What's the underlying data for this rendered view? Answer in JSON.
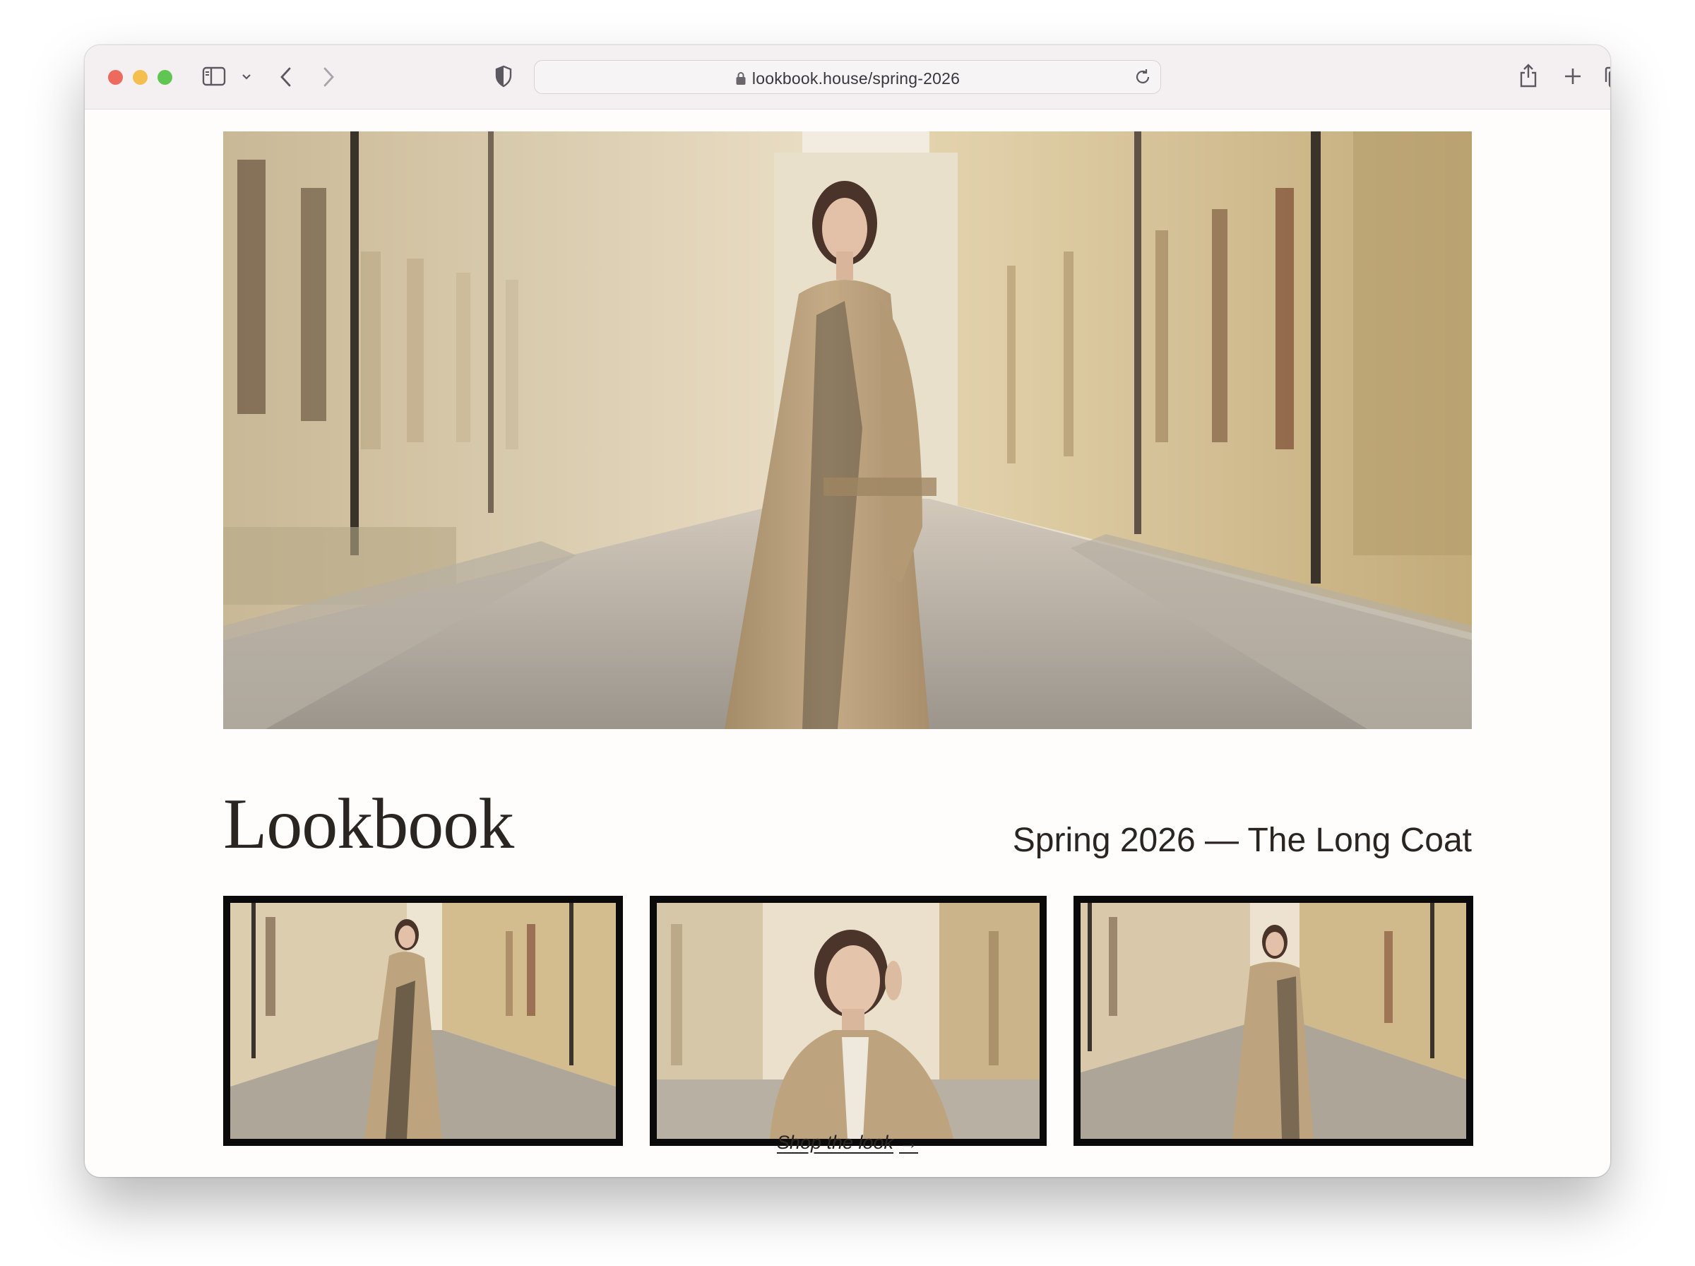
{
  "browser": {
    "url": "lookbook.house/spring-2026",
    "traffic_lights": {
      "close": "#ed6a5e",
      "minimize": "#f4bf4f",
      "zoom": "#61c554"
    },
    "icons": [
      "sidebar-icon",
      "chevron-down-icon",
      "back-icon",
      "forward-icon",
      "shield-icon",
      "lock-icon",
      "reload-icon",
      "share-icon",
      "new-tab-icon",
      "tabs-overview-icon"
    ]
  },
  "page": {
    "title": "Lookbook",
    "subtitle": "Spring 2026 — The Long Coat",
    "cta_label": "Shop the look",
    "cta_arrow": "→"
  },
  "colors": {
    "text": "#2b2521",
    "coat": "#b9a07c",
    "building_warm": "#d9c8a4",
    "cobblestone": "#a8a19a",
    "thumb_border": "#0a0a0a"
  }
}
